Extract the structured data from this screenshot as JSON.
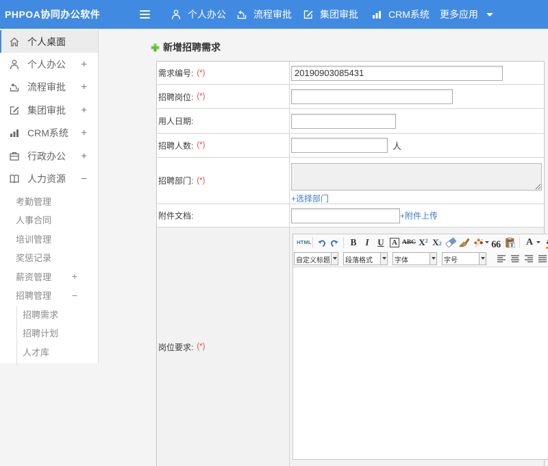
{
  "colors": {
    "accent": "#418ae2",
    "link": "#3b7bd0",
    "required": "#e24c4c"
  },
  "header": {
    "logo": "PHPOA协同办公软件",
    "nav": [
      {
        "label": "个人办公",
        "icon": "user-icon"
      },
      {
        "label": "流程审批",
        "icon": "process-icon"
      },
      {
        "label": "集团审批",
        "icon": "edit-icon"
      },
      {
        "label": "CRM系统",
        "icon": "chart-icon"
      },
      {
        "label": "更多应用",
        "icon": "caret-down-icon"
      }
    ]
  },
  "sidebar": {
    "items": [
      {
        "label": "个人桌面",
        "icon": "home-icon",
        "selected": true
      },
      {
        "label": "个人办公",
        "icon": "user-icon",
        "expand": "+"
      },
      {
        "label": "流程审批",
        "icon": "process-icon",
        "expand": "+"
      },
      {
        "label": "集团审批",
        "icon": "edit-icon",
        "expand": "+"
      },
      {
        "label": "CRM系统",
        "icon": "chart-icon",
        "expand": "+"
      },
      {
        "label": "行政办公",
        "icon": "briefcase-icon",
        "expand": "+"
      },
      {
        "label": "人力资源",
        "icon": "book-icon",
        "expand": "−"
      }
    ],
    "hr_children": [
      {
        "label": "考勤管理"
      },
      {
        "label": "人事合同"
      },
      {
        "label": "培训管理"
      },
      {
        "label": "奖惩记录"
      },
      {
        "label": "薪资管理",
        "expand": "+"
      },
      {
        "label": "招聘管理",
        "expand": "−"
      }
    ],
    "recruit_children": [
      {
        "label": "招聘需求"
      },
      {
        "label": "招聘计划"
      },
      {
        "label": "人才库"
      }
    ]
  },
  "main": {
    "title": "新增招聘需求",
    "form": {
      "req_no": {
        "label": "需求编号:",
        "required": "(*)",
        "value": "20190903085431"
      },
      "position": {
        "label": "招聘岗位:",
        "required": "(*)",
        "value": ""
      },
      "date": {
        "label": "用人日期:",
        "value": ""
      },
      "count": {
        "label": "招聘人数:",
        "required": "(*)",
        "value": "",
        "suffix": "人"
      },
      "dept": {
        "label": "招聘部门:",
        "required": "(*)",
        "link": "+选择部门"
      },
      "attach": {
        "label": "附件文档:",
        "value": "",
        "link": "+附件上传"
      },
      "require": {
        "label": "岗位要求:",
        "required": "(*)"
      }
    }
  },
  "editor": {
    "html_button": "HTML",
    "quote": "66",
    "toolbar_icons": [
      "source-code",
      "undo",
      "redo",
      "bold",
      "italic",
      "underline",
      "font-border",
      "strikethrough",
      "superscript",
      "subscript",
      "remove-format",
      "format-brush",
      "scrawl",
      "dropdown-arrow",
      "blockquote",
      "paste-text",
      "font-color",
      "background-color",
      "justify-left",
      "justify-center",
      "justify-right",
      "justify-full"
    ],
    "dropdowns": [
      {
        "label": "自定义标题"
      },
      {
        "label": "段落格式"
      },
      {
        "label": "字体"
      },
      {
        "label": "字号"
      }
    ]
  }
}
